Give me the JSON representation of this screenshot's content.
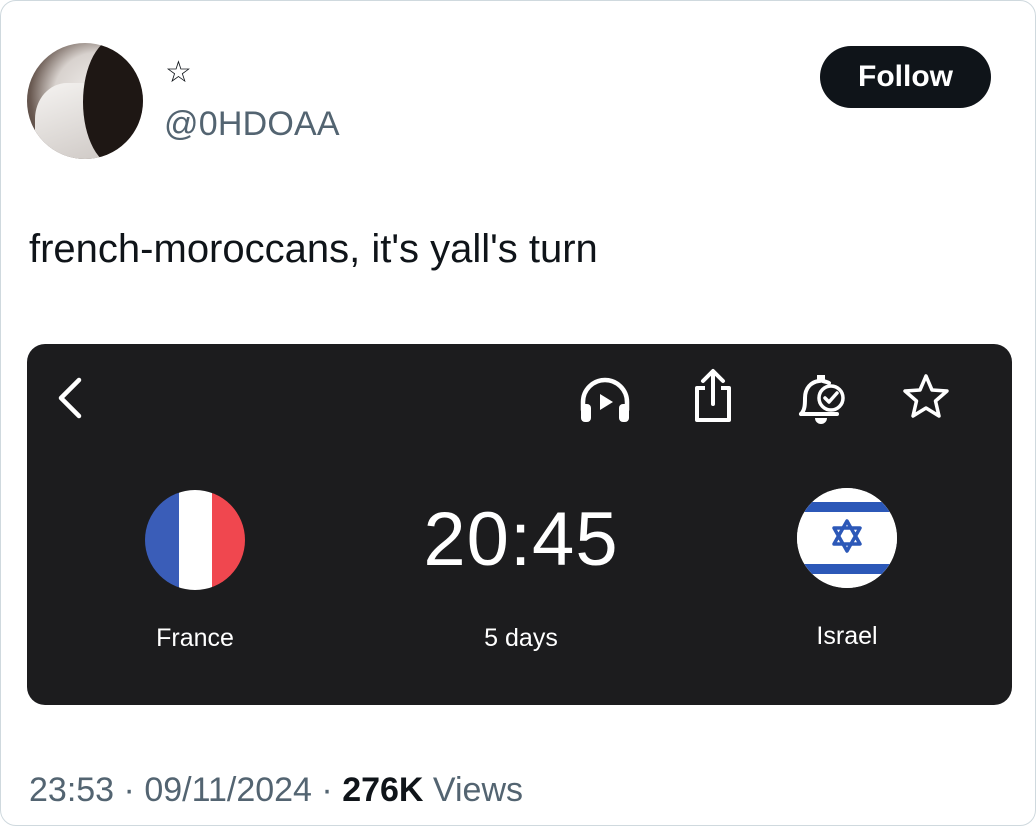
{
  "author": {
    "display_name": "☆",
    "handle": "@0HDOAA"
  },
  "follow_label": "Follow",
  "tweet_text": "french-moroccans, it's yall's turn",
  "media": {
    "icons": [
      "back-icon",
      "headphones-icon",
      "share-icon",
      "bell-check-icon",
      "star-icon"
    ],
    "home_team": "France",
    "away_team": "Israel",
    "kickoff_time": "20:45",
    "countdown": "5 days",
    "colors": {
      "background": "#1c1c1e",
      "fr_blue": "#3a5db8",
      "fr_red": "#f0474f",
      "il_blue": "#2c58b8"
    }
  },
  "meta": {
    "time": "23:53",
    "sep1": " · ",
    "date": "09/11/2024",
    "sep2": " · ",
    "views_count": "276K",
    "views_label": " Views"
  }
}
